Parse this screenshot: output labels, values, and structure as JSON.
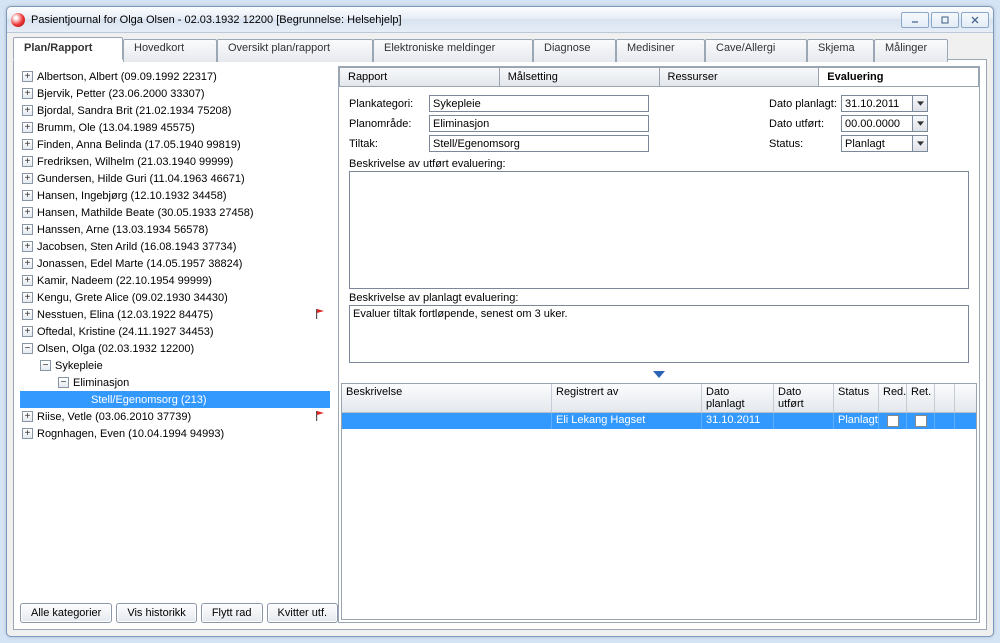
{
  "window": {
    "title": "Pasientjournal for Olga Olsen - 02.03.1932 12200   [Begrunnelse: Helsehjelp]"
  },
  "main_tabs": [
    "Plan/Rapport",
    "Hovedkort",
    "Oversikt plan/rapport",
    "Elektroniske meldinger",
    "Diagnose",
    "Medisiner",
    "Cave/Allergi",
    "Skjema",
    "Målinger"
  ],
  "main_tab_active": 0,
  "tree": [
    {
      "exp": "+",
      "label": "Albertson, Albert (09.09.1992 22317)",
      "indent": 0
    },
    {
      "exp": "+",
      "label": "Bjervik, Petter (23.06.2000 33307)",
      "indent": 0
    },
    {
      "exp": "+",
      "label": "Bjordal, Sandra Brit (21.02.1934 75208)",
      "indent": 0
    },
    {
      "exp": "+",
      "label": "Brumm, Ole (13.04.1989 45575)",
      "indent": 0
    },
    {
      "exp": "+",
      "label": "Finden, Anna Belinda (17.05.1940 99819)",
      "indent": 0
    },
    {
      "exp": "+",
      "label": "Fredriksen, Wilhelm (21.03.1940 99999)",
      "indent": 0
    },
    {
      "exp": "+",
      "label": "Gundersen, Hilde Guri (11.04.1963 46671)",
      "indent": 0
    },
    {
      "exp": "+",
      "label": "Hansen, Ingebjørg (12.10.1932 34458)",
      "indent": 0
    },
    {
      "exp": "+",
      "label": "Hansen, Mathilde Beate (30.05.1933 27458)",
      "indent": 0
    },
    {
      "exp": "+",
      "label": "Hanssen, Arne (13.03.1934 56578)",
      "indent": 0
    },
    {
      "exp": "+",
      "label": "Jacobsen, Sten Arild (16.08.1943 37734)",
      "indent": 0
    },
    {
      "exp": "+",
      "label": "Jonassen, Edel Marte (14.05.1957 38824)",
      "indent": 0
    },
    {
      "exp": "+",
      "label": "Kamir, Nadeem (22.10.1954 99999)",
      "indent": 0
    },
    {
      "exp": "+",
      "label": "Kengu, Grete Alice (09.02.1930 34430)",
      "indent": 0
    },
    {
      "exp": "+",
      "label": "Nesstuen, Elina (12.03.1922 84475)",
      "indent": 0,
      "flag": true
    },
    {
      "exp": "+",
      "label": "Oftedal, Kristine (24.11.1927 34453)",
      "indent": 0
    },
    {
      "exp": "-",
      "label": "Olsen, Olga (02.03.1932 12200)",
      "indent": 0
    },
    {
      "exp": "-",
      "label": "Sykepleie",
      "indent": 1
    },
    {
      "exp": "-",
      "label": "Eliminasjon",
      "indent": 2
    },
    {
      "exp": "",
      "label": "Stell/Egenomsorg (213)",
      "indent": 3,
      "sel": true
    },
    {
      "exp": "+",
      "label": "Riise, Vetle (03.06.2010 37739)",
      "indent": 0,
      "flag": true
    },
    {
      "exp": "+",
      "label": "Rognhagen, Even (10.04.1994 94993)",
      "indent": 0
    }
  ],
  "left_buttons": [
    "Alle kategorier",
    "Vis historikk",
    "Flytt rad",
    "Kvitter utf."
  ],
  "sub_tabs": [
    "Rapport",
    "Målsetting",
    "Ressurser",
    "Evaluering"
  ],
  "sub_tab_active": 3,
  "form": {
    "plankategori_label": "Plankategori:",
    "plankategori_value": "Sykepleie",
    "planomrade_label": "Planområde:",
    "planomrade_value": "Eliminasjon",
    "tiltak_label": "Tiltak:",
    "tiltak_value": "Stell/Egenomsorg",
    "dato_planlagt_label": "Dato planlagt:",
    "dato_planlagt_value": "31.10.2011",
    "dato_utfort_label": "Dato utført:",
    "dato_utfort_value": "00.00.0000",
    "status_label": "Status:",
    "status_value": "Planlagt",
    "beskriv_utfort_label": "Beskrivelse av utført evaluering:",
    "beskriv_utfort_value": "",
    "beskriv_planlagt_label": "Beskrivelse av planlagt evaluering:",
    "beskriv_planlagt_value": "Evaluer tiltak fortløpende, senest om 3 uker."
  },
  "grid": {
    "columns": [
      "Beskrivelse",
      "Registrert av",
      "Dato planlagt",
      "Dato utført",
      "Status",
      "Red.",
      "Ret.",
      ""
    ],
    "row": {
      "beskrivelse": "",
      "registrert_av": "Eli Lekang Hagset",
      "dato_planlagt": "31.10.2011",
      "dato_utfort": "",
      "status": "Planlagt"
    }
  }
}
